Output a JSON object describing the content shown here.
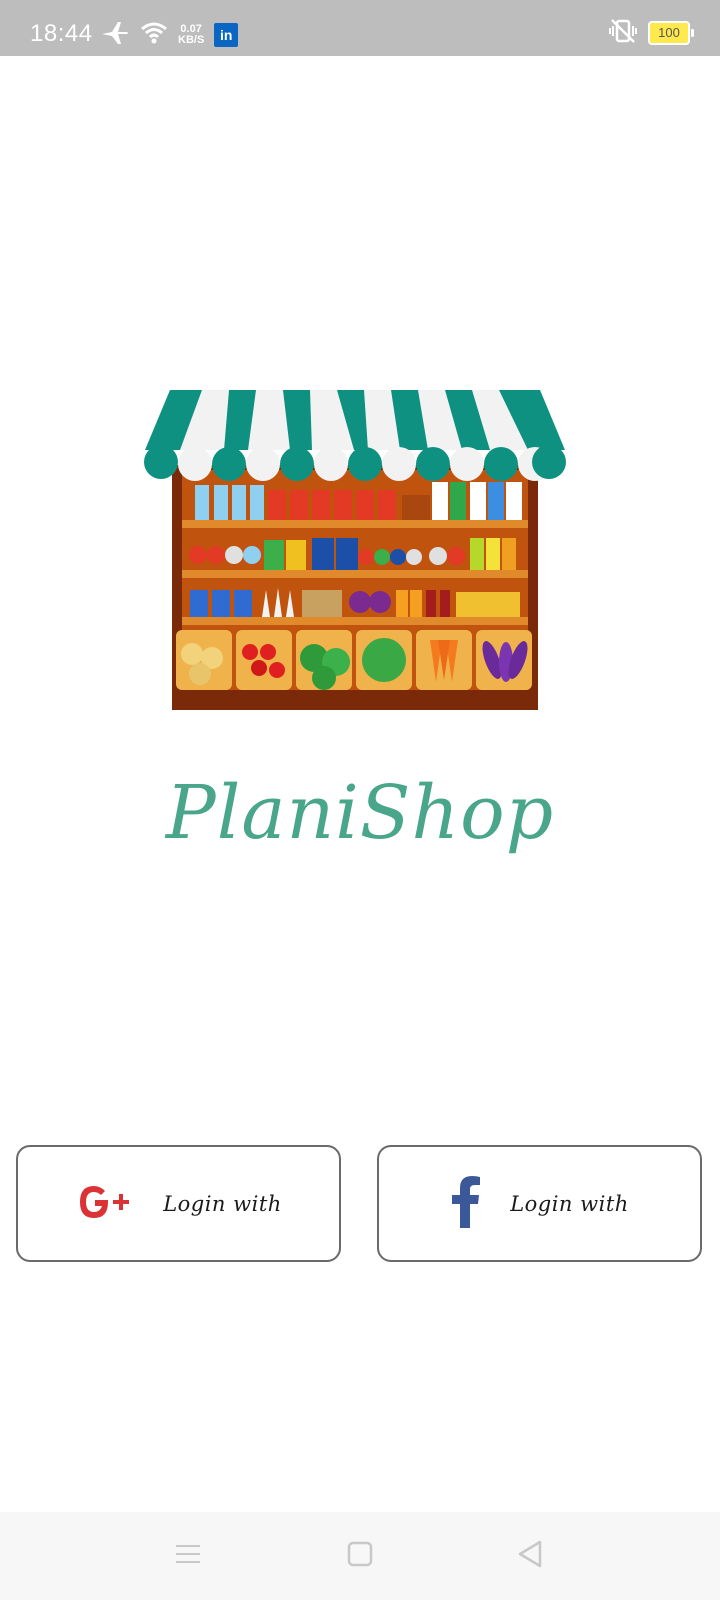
{
  "status_bar": {
    "time": "18:44",
    "net_speed_value": "0.07",
    "net_speed_unit": "KB/S",
    "linkedin_label": "in",
    "battery": "100",
    "icons": [
      "airplane-icon",
      "wifi-icon",
      "linkedin-icon",
      "vibrate-icon",
      "battery-icon"
    ]
  },
  "app": {
    "title": "PlaniShop"
  },
  "login": {
    "google_label": "Login with",
    "google_icon_text": "G+",
    "facebook_label": "Login with",
    "facebook_icon_text": "f"
  },
  "nav": {
    "icons": [
      "menu-icon",
      "home-icon",
      "back-icon"
    ]
  },
  "colors": {
    "status_bar": "#bdbdbd",
    "title": "#4aa68a",
    "google": "#db3236",
    "facebook": "#3b5998",
    "awning_green": "#0f9182",
    "shelf": "#b5470a"
  }
}
